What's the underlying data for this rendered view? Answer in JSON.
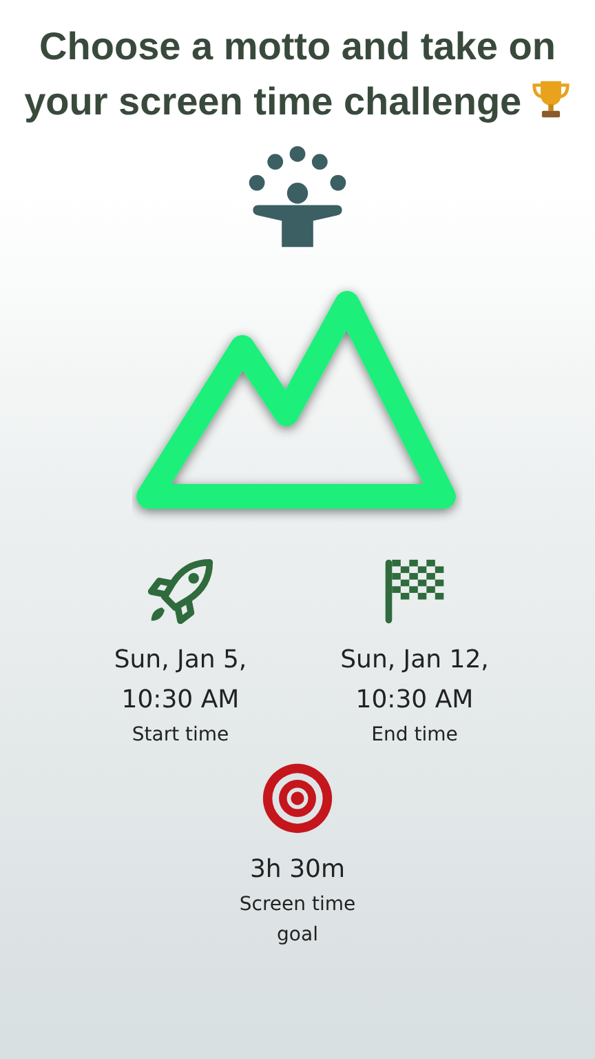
{
  "title": "Choose a motto and take on your screen time challenge",
  "stats": [
    {
      "kind": "start",
      "value": "Sun, Jan 5, 10:30 AM",
      "label": "Start time"
    },
    {
      "kind": "end",
      "value": "Sun, Jan 12, 10:30 AM",
      "label": "End time"
    },
    {
      "kind": "goal",
      "value": "3h 30m",
      "label": "Screen time goal"
    }
  ]
}
